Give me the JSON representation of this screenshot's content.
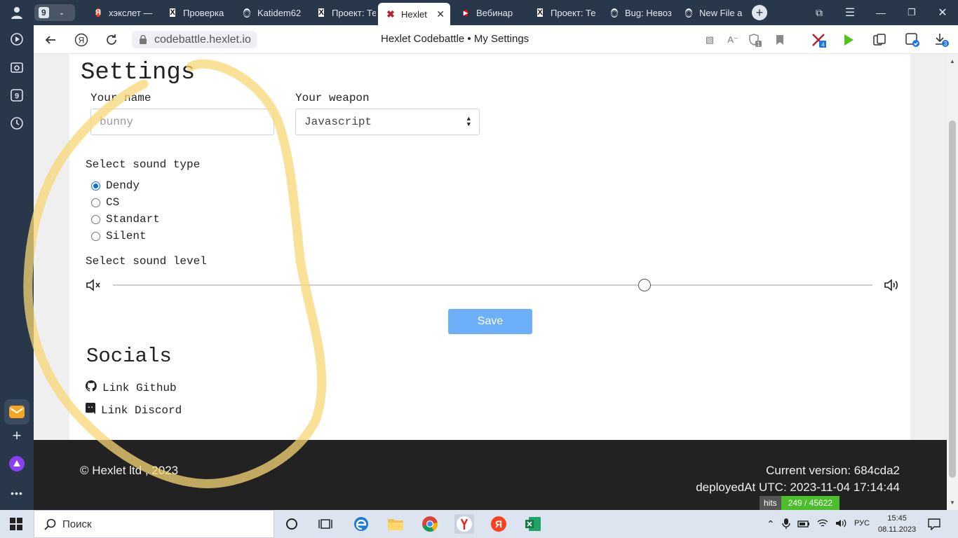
{
  "browser": {
    "tab_count": "9",
    "tabs": [
      {
        "label": "хэкслет —",
        "icon": "yandex-icon"
      },
      {
        "label": "Проверка",
        "icon": "hexlet-icon"
      },
      {
        "label": "Katidem62",
        "icon": "github-icon"
      },
      {
        "label": "Проект: Те",
        "icon": "hexlet-icon"
      },
      {
        "label": "Hexlet",
        "icon": "codebattle-icon"
      },
      {
        "label": "Вебинар",
        "icon": "youtube-icon"
      },
      {
        "label": "Проект: Те",
        "icon": "hexlet-icon"
      },
      {
        "label": "Bug: Невоз",
        "icon": "github-icon"
      },
      {
        "label": "New File a",
        "icon": "github-icon"
      }
    ],
    "url": "codebattle.hexlet.io",
    "page_title": "Hexlet Codebattle • My Settings",
    "badges": {
      "alice": "1",
      "extension": "4",
      "downloads": "3"
    }
  },
  "settings": {
    "title": "Settings",
    "name_label": "Your name",
    "name_value": "bunny",
    "weapon_label": "Your weapon",
    "weapon_value": "Javascript",
    "sound_type_label": "Select sound type",
    "sound_types": [
      "Dendy",
      "CS",
      "Standart",
      "Silent"
    ],
    "selected_sound": "Dendy",
    "sound_level_label": "Select sound level",
    "sound_level": 0.7,
    "save_label": "Save"
  },
  "socials": {
    "title": "Socials",
    "github": "Link Github",
    "discord": "Link Discord"
  },
  "footer": {
    "copyright": "© Hexlet ltd , 2023",
    "version": "Current version: 684cda2",
    "deployed": "deployedAt UTC: 2023-11-04 17:14:44",
    "hits_label": "hits",
    "hits_value": "249 / 45622"
  },
  "taskbar": {
    "search_placeholder": "Поиск",
    "lang": "РУС",
    "time": "15:45",
    "date": "08.11.2023"
  },
  "colors": {
    "accent": "#6cb0f9",
    "annotation": "#f7d774",
    "chrome_dark": "#29374a",
    "footer": "#222222"
  }
}
